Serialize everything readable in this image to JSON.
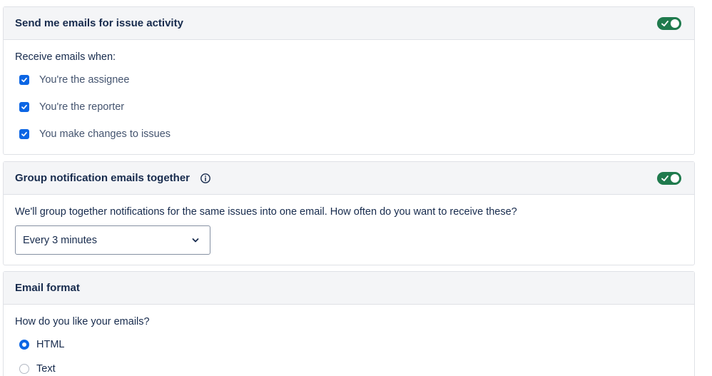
{
  "issue_activity": {
    "title": "Send me emails for issue activity",
    "toggle_on": true,
    "intro": "Receive emails when:",
    "options": [
      {
        "label": "You're the assignee",
        "checked": true
      },
      {
        "label": "You're the reporter",
        "checked": true
      },
      {
        "label": "You make changes to issues",
        "checked": true
      }
    ]
  },
  "group_notifications": {
    "title": "Group notification emails together",
    "toggle_on": true,
    "info_icon": "info-icon",
    "description": "We'll group together notifications for the same issues into one email. How often do you want to receive these?",
    "frequency_value": "Every 3 minutes"
  },
  "email_format": {
    "title": "Email format",
    "question": "How do you like your emails?",
    "options": [
      {
        "label": "HTML",
        "selected": true
      },
      {
        "label": "Text",
        "selected": false
      }
    ]
  },
  "colors": {
    "toggle_on": "#1f7a4d",
    "checkbox": "#0c66e4",
    "header_bg": "#f4f5f7",
    "border": "#dfe1e6"
  }
}
